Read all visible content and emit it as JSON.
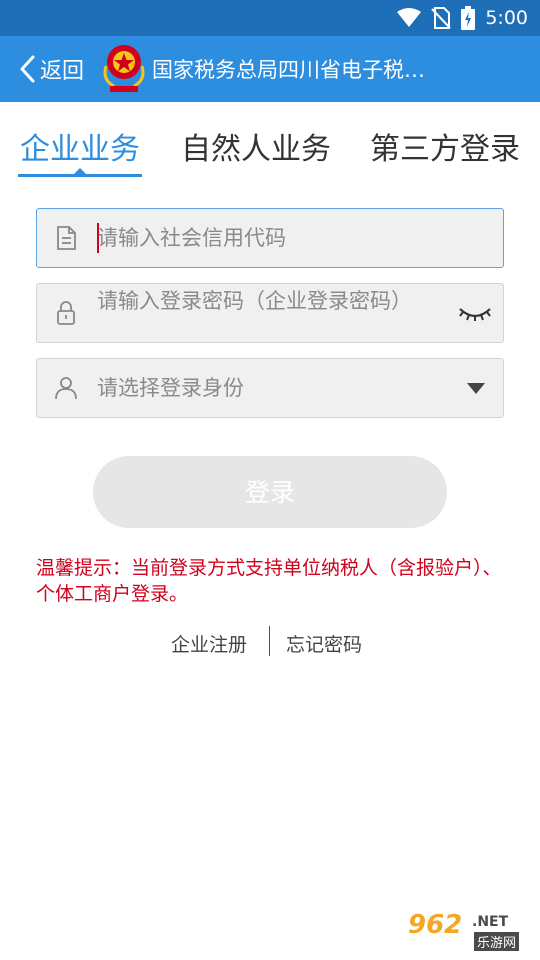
{
  "status_bar": {
    "time": "5:00"
  },
  "app_bar": {
    "back_label": "返回",
    "title": "国家税务总局四川省电子税…"
  },
  "tabs": [
    {
      "label": "企业业务",
      "active": true
    },
    {
      "label": "自然人业务",
      "active": false
    },
    {
      "label": "第三方登录",
      "active": false
    }
  ],
  "form": {
    "credit_code": {
      "placeholder": "请输入社会信用代码",
      "value": ""
    },
    "password": {
      "placeholder": "请输入登录密码（企业登录密码）"
    },
    "identity": {
      "placeholder": "请选择登录身份"
    },
    "login_label": "登录"
  },
  "tip": "温馨提示：当前登录方式支持单位纳税人（含报验户）、个体工商户登录。",
  "links": {
    "register": "企业注册",
    "forgot": "忘记密码"
  },
  "watermark": {
    "num": "962",
    "net": ".NET",
    "sub": "乐游网"
  },
  "colors": {
    "status_bar": "#1f6fb8",
    "app_bar": "#2d8ee0",
    "accent": "#2d8ee0",
    "tip_text": "#d0021b",
    "button_disabled": "#e6e6e6"
  },
  "icons": {
    "status": [
      "wifi-icon",
      "no-sim-icon",
      "battery-charging-icon"
    ],
    "fields": [
      "document-icon",
      "lock-icon",
      "person-icon"
    ]
  }
}
